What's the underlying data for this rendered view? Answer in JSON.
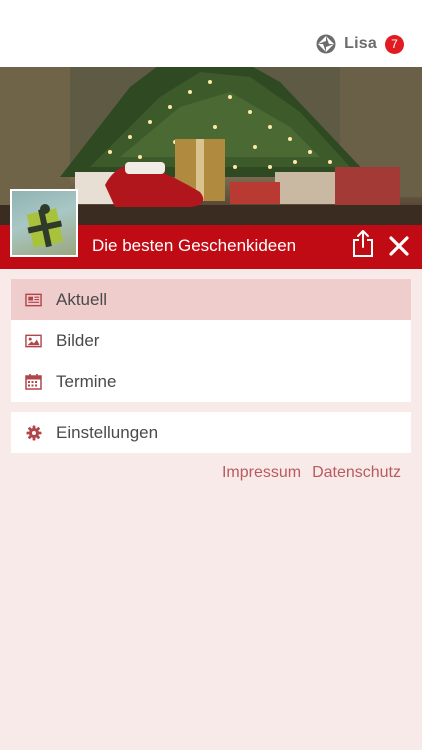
{
  "header": {
    "user_name": "Lisa",
    "notification_count": "7"
  },
  "page": {
    "title": "Die besten Geschenkideen"
  },
  "menu": {
    "items": [
      {
        "label": "Aktuell",
        "icon": "newspaper-icon",
        "active": true
      },
      {
        "label": "Bilder",
        "icon": "image-icon",
        "active": false
      },
      {
        "label": "Termine",
        "icon": "calendar-icon",
        "active": false
      }
    ],
    "settings": {
      "label": "Einstellungen",
      "icon": "gear-icon"
    }
  },
  "footer": {
    "impressum": "Impressum",
    "datenschutz": "Datenschutz"
  },
  "colors": {
    "brand_red": "#c00b14",
    "badge_red": "#e01b22",
    "active_item": "#f0cdcd",
    "background": "#f9eaea",
    "icon_red": "#b0454a",
    "link": "#b85a5e"
  }
}
